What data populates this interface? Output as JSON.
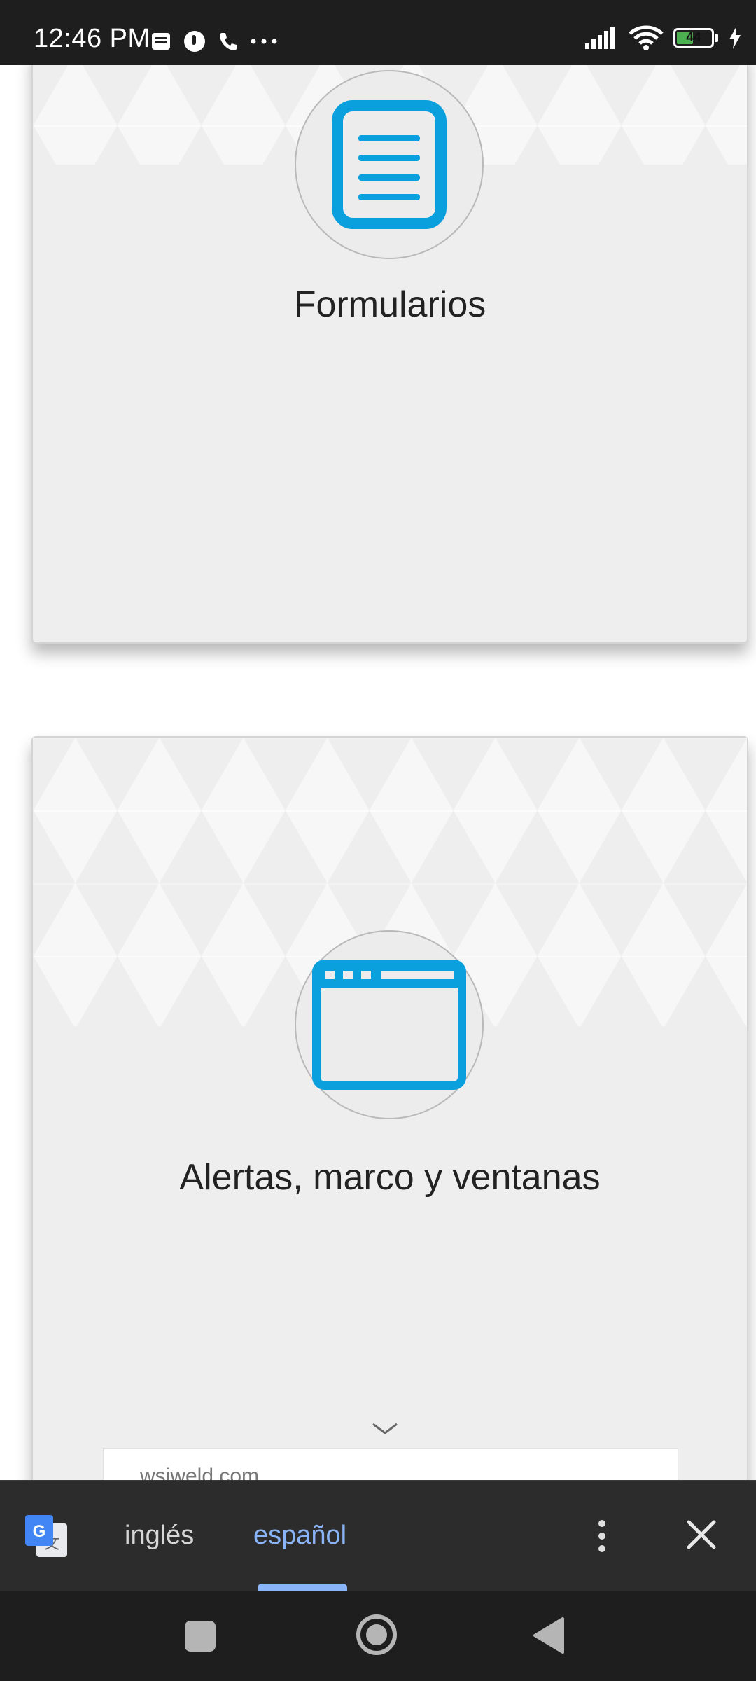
{
  "status_bar": {
    "time": "12:46 PM",
    "battery_level": "44",
    "icons": [
      "message-icon",
      "notification-icon",
      "phone-icon",
      "more-dots-icon",
      "signal-icon",
      "wifi-icon",
      "battery-icon",
      "charging-icon"
    ]
  },
  "cards": [
    {
      "title": "Formularios",
      "icon": "document-icon"
    },
    {
      "title": "Alertas, marco y ventanas",
      "icon": "window-icon"
    }
  ],
  "site_chip": {
    "text": "wsiweld.com"
  },
  "translate_bar": {
    "source_language": "inglés",
    "target_language": "español",
    "selected": "español"
  },
  "colors": {
    "accent": "#0aa0dd",
    "translate_accent": "#8ab4f8",
    "card_background": "#eeeeee"
  },
  "nav_bar": {
    "buttons": [
      "recents-button",
      "home-button",
      "back-button"
    ]
  }
}
